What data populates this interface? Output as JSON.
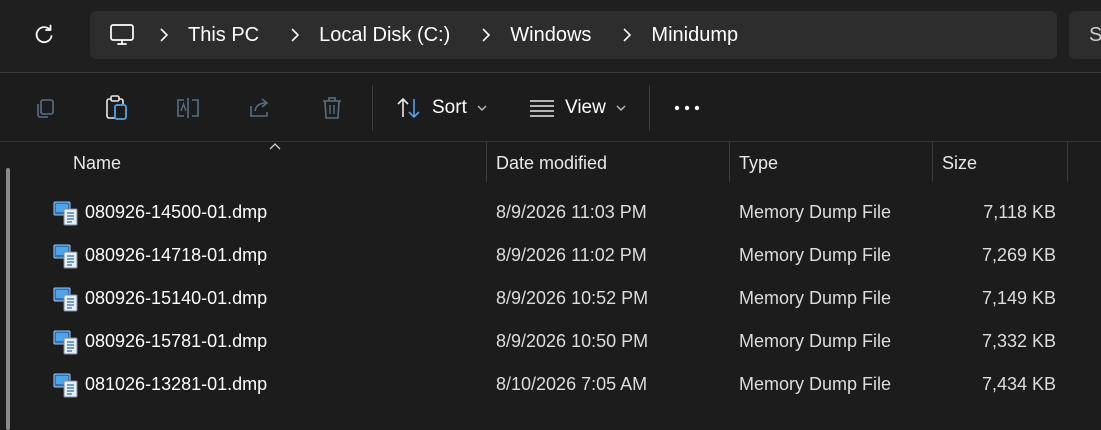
{
  "address": {
    "crumbs": [
      "This PC",
      "Local Disk (C:)",
      "Windows",
      "Minidump"
    ],
    "search_fragment": "S"
  },
  "toolbar": {
    "sort_label": "Sort",
    "view_label": "View"
  },
  "columns": {
    "name": "Name",
    "date": "Date modified",
    "type": "Type",
    "size": "Size"
  },
  "files": [
    {
      "name": "080926-14500-01.dmp",
      "date": "8/9/2026 11:03 PM",
      "type": "Memory Dump File",
      "size": "7,118 KB"
    },
    {
      "name": "080926-14718-01.dmp",
      "date": "8/9/2026 11:02 PM",
      "type": "Memory Dump File",
      "size": "7,269 KB"
    },
    {
      "name": "080926-15140-01.dmp",
      "date": "8/9/2026 10:52 PM",
      "type": "Memory Dump File",
      "size": "7,149 KB"
    },
    {
      "name": "080926-15781-01.dmp",
      "date": "8/9/2026 10:50 PM",
      "type": "Memory Dump File",
      "size": "7,332 KB"
    },
    {
      "name": "081026-13281-01.dmp",
      "date": "8/10/2026 7:05 AM",
      "type": "Memory Dump File",
      "size": "7,434 KB"
    }
  ],
  "icons": {
    "refresh": "refresh-icon",
    "pc": "computer-icon",
    "copy": "copy-icon",
    "paste": "paste-icon",
    "rename": "rename-icon",
    "share": "share-icon",
    "delete": "delete-icon",
    "sort": "sort-icon",
    "view": "view-icon",
    "more": "more-icon",
    "file": "dump-file-icon"
  },
  "colors": {
    "background": "#1c1c1c",
    "address_bar": "#2d2d2d",
    "accent_icon": "#4fa3e8"
  }
}
